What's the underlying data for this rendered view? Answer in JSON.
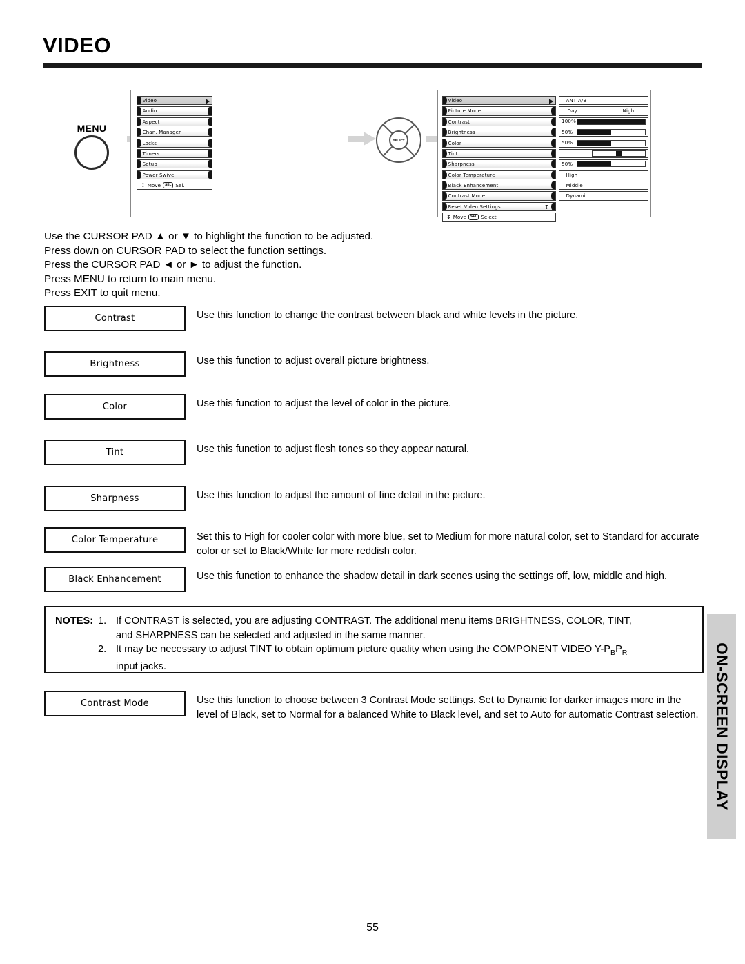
{
  "page": {
    "title": "VIDEO",
    "number": "55",
    "side_tab": "ON-SCREEN DISPLAY"
  },
  "flow": {
    "menu_button_label": "MENU",
    "cursor_pad_center_label": "SELECT",
    "arrow_icon": "right-arrow-icon"
  },
  "osd_main_menu": {
    "header": "Video",
    "items": [
      "Audio",
      "Aspect",
      "Chan. Manager",
      "Locks",
      "Timers",
      "Setup",
      "Power Swivel"
    ],
    "footer": {
      "move_label": "Move",
      "sel_key": "SEL",
      "select_label": "Sel."
    }
  },
  "osd_video_menu": {
    "header": "Video",
    "items": [
      "Picture Mode",
      "Contrast",
      "Brightness",
      "Color",
      "Tint",
      "Sharpness",
      "Color Temperature",
      "Black Enhancement",
      "Contrast Mode",
      "Reset Video Settings"
    ],
    "values": [
      {
        "kind": "text",
        "text": "ANT A/B"
      },
      {
        "kind": "pair",
        "left": "Day",
        "right": "Night"
      },
      {
        "kind": "slider",
        "percent": "100%",
        "fill": 100
      },
      {
        "kind": "slider",
        "percent": "50%",
        "fill": 50
      },
      {
        "kind": "slider",
        "percent": "50%",
        "fill": 50
      },
      {
        "kind": "knob",
        "percent": "",
        "position": 50
      },
      {
        "kind": "slider",
        "percent": "50%",
        "fill": 50
      },
      {
        "kind": "text",
        "text": "High"
      },
      {
        "kind": "text",
        "text": "Middle"
      },
      {
        "kind": "text",
        "text": "Dynamic"
      }
    ],
    "footer": {
      "move_label": "Move",
      "sel_key": "SEL",
      "select_label": "Select"
    }
  },
  "instructions": [
    "Use the CURSOR PAD ▲ or ▼ to highlight the function to be adjusted.",
    "Press down on CURSOR PAD to select the function settings.",
    "Press the CURSOR PAD ◄ or ► to adjust the function.",
    "Press MENU to return to main menu.",
    "Press EXIT to quit menu."
  ],
  "features": [
    {
      "name": "Contrast",
      "desc": "Use this function to change the contrast between black and white levels in the picture."
    },
    {
      "name": "Brightness",
      "desc": "Use this function to adjust overall picture brightness."
    },
    {
      "name": "Color",
      "desc": "Use this function to adjust the level of color in the picture."
    },
    {
      "name": "Tint",
      "desc": "Use this function to adjust flesh tones so they appear natural."
    },
    {
      "name": "Sharpness",
      "desc": "Use this function to adjust the amount of fine detail in the picture."
    },
    {
      "name": "Color Temperature",
      "desc": "Set this to High for cooler color with more blue, set to Medium for more natural color, set to Standard for accurate color or set to Black/White for more reddish color."
    },
    {
      "name": "Black Enhancement",
      "desc": "Use this function to enhance the shadow detail in dark scenes using the settings off, low, middle and high."
    }
  ],
  "contrast_mode_feature": {
    "name": "Contrast Mode",
    "desc": "Use this function to choose between 3 Contrast Mode settings.  Set to Dynamic for darker images more in the level of Black, set to Normal for a balanced White to Black level, and set to Auto for automatic Contrast selection."
  },
  "notes": {
    "label": "NOTES:",
    "items": [
      {
        "num": "1.",
        "line1": "If CONTRAST is selected, you are adjusting CONTRAST.  The additional menu items BRIGHTNESS, COLOR, TINT,",
        "line2": "and SHARPNESS can be selected and adjusted in the same manner."
      },
      {
        "num": "2.",
        "line1_a": "It may be necessary to adjust TINT to obtain optimum picture quality when using the COMPONENT VIDEO Y-P",
        "line1_sub1": "B",
        "line1_b": "P",
        "line1_sub2": "R",
        "line2": "input jacks."
      }
    ]
  }
}
